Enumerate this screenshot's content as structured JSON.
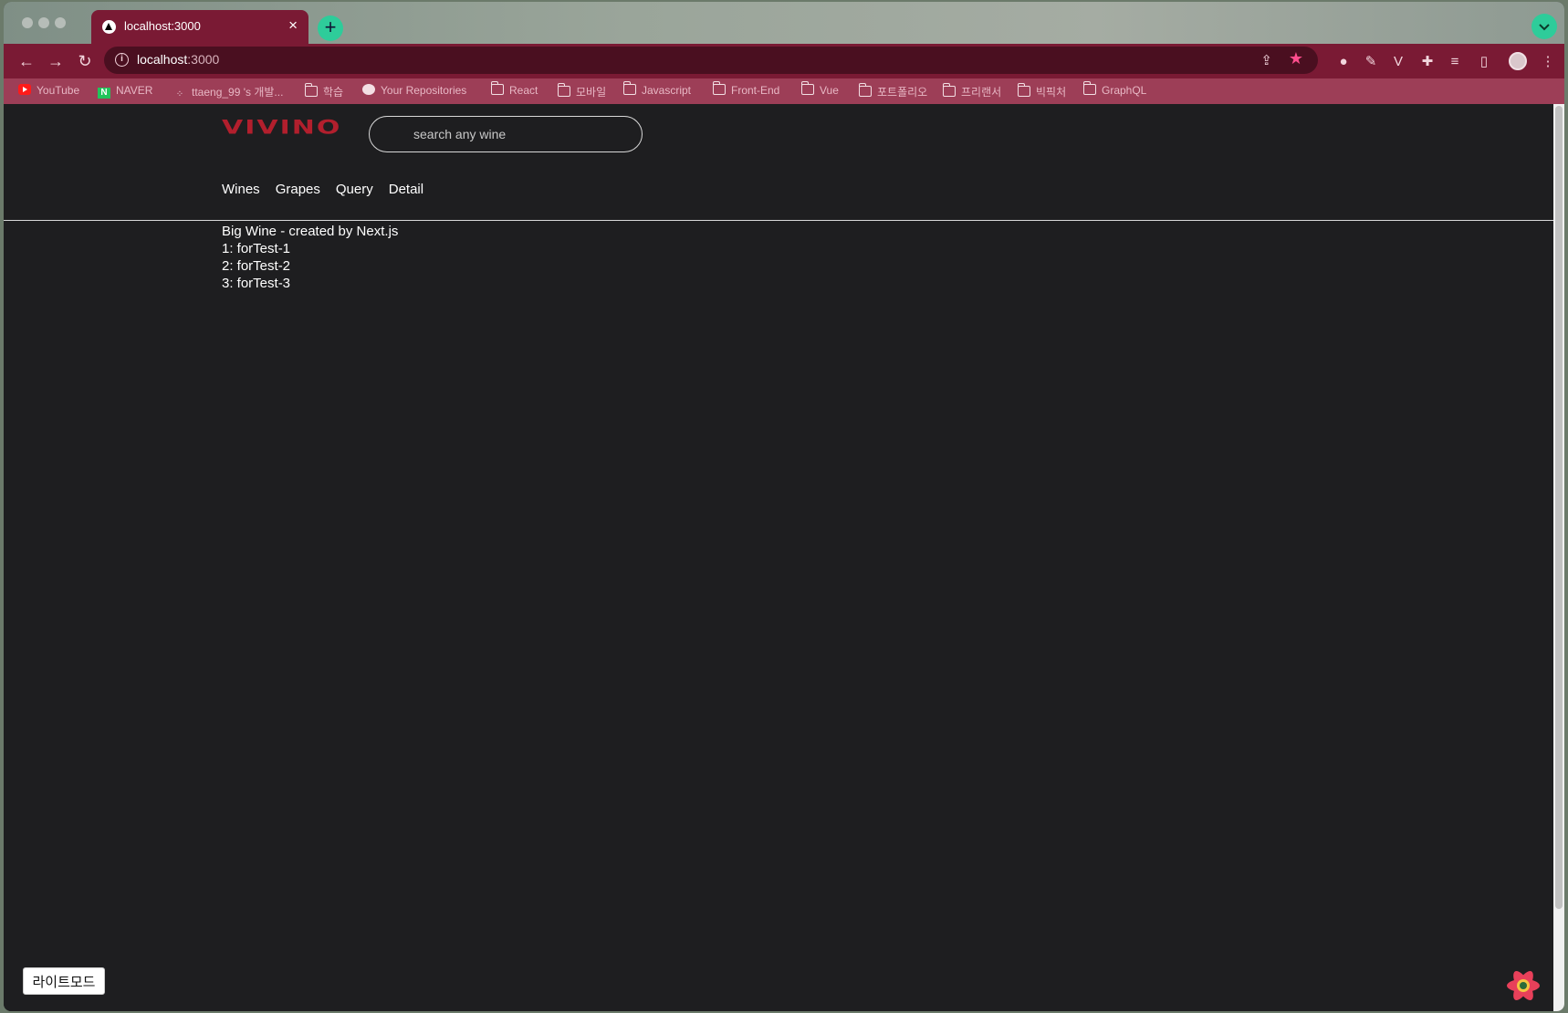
{
  "browser": {
    "tab": {
      "title": "localhost:3000",
      "close": "×"
    },
    "new_tab": "+",
    "tab_menu": "⌄",
    "url": {
      "host": "localhost",
      "port": ":3000"
    },
    "bookmarks": [
      {
        "label": "YouTube",
        "icon": "youtube-icon"
      },
      {
        "label": "NAVER",
        "icon": "naver-icon"
      },
      {
        "label": "ttaeng_99 's 개발...",
        "icon": "tistory-icon"
      },
      {
        "label": "학습",
        "icon": "folder-icon"
      },
      {
        "label": "Your Repositories",
        "icon": "github-icon"
      },
      {
        "label": "React",
        "icon": "folder-icon"
      },
      {
        "label": "모바일",
        "icon": "folder-icon"
      },
      {
        "label": "Javascript",
        "icon": "folder-icon"
      },
      {
        "label": "Front-End",
        "icon": "folder-icon"
      },
      {
        "label": "Vue",
        "icon": "folder-icon"
      },
      {
        "label": "포트폴리오",
        "icon": "folder-icon"
      },
      {
        "label": "프리랜서",
        "icon": "folder-icon"
      },
      {
        "label": "빅픽처",
        "icon": "folder-icon"
      },
      {
        "label": "GraphQL",
        "icon": "folder-icon"
      }
    ]
  },
  "header": {
    "logo": "VIVINO",
    "search_placeholder": "search any wine",
    "nav": [
      "Wines",
      "Grapes",
      "Query",
      "Detail"
    ]
  },
  "content": {
    "title": "Big Wine - created by Next.js",
    "items": [
      "1: forTest-1",
      "2: forTest-2",
      "3: forTest-3"
    ]
  },
  "footer": {
    "mode_button": "라이트모드"
  },
  "colors": {
    "brand": "#b21f2d",
    "page_bg": "#1e1e20",
    "chrome": "#7a1a34"
  }
}
